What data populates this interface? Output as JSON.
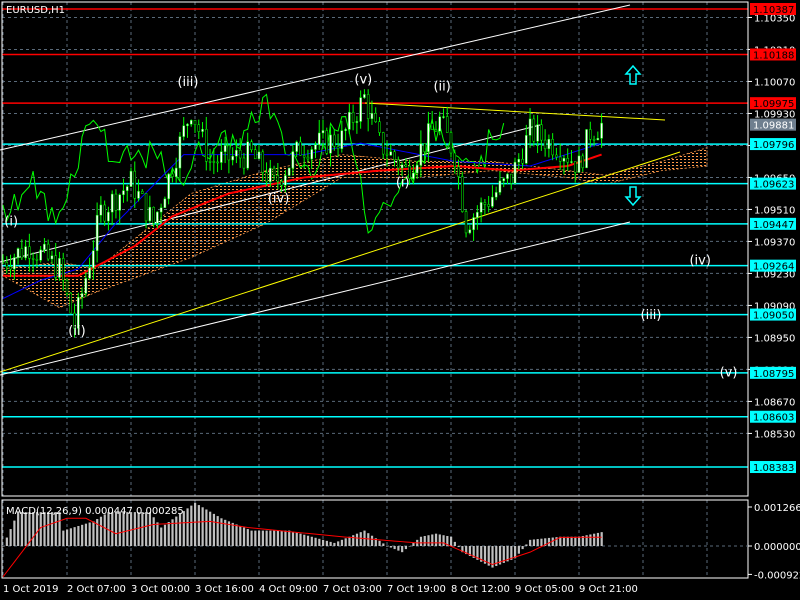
{
  "window_title": "EURUSD,H1",
  "colors": {
    "background": "#000000",
    "grid": "#5a6a7a",
    "red_level": "#ff0000",
    "cyan_level": "#00ffff",
    "bid": "#6f7f8f",
    "candle": "#00ff00",
    "kijun": "#ff0000",
    "tenkan": "#0000ff",
    "cloud": "#ff9b4a",
    "signal": "#ff0000",
    "hist": "#c0c0c0",
    "trend_yellow": "#ffff00",
    "trend_white": "#ffffff"
  },
  "chart_data": {
    "type": "candlestick",
    "symbol": "EURUSD",
    "timeframe": "H1",
    "ylim": [
      1.0826,
      1.1042
    ],
    "price_ticks": [
      "1.10350",
      "1.10210",
      "1.10070",
      "1.09930",
      "1.09790",
      "1.09650",
      "1.09510",
      "1.09370",
      "1.09230",
      "1.09090",
      "1.08950",
      "1.08810",
      "1.08670",
      "1.08530"
    ],
    "time_labels": [
      "1 Oct 2019",
      "2 Oct 07:00",
      "3 Oct 00:00",
      "3 Oct 16:00",
      "4 Oct 09:00",
      "7 Oct 03:00",
      "7 Oct 19:00",
      "8 Oct 12:00",
      "9 Oct 05:00",
      "9 Oct 21:00"
    ],
    "bars_per_label": 17,
    "levels_red": [
      "1.10387",
      "1.10188",
      "1.09975"
    ],
    "levels_cyan": [
      "1.09796",
      "1.09623",
      "1.09447",
      "1.09264",
      "1.09050",
      "1.08795",
      "1.08603",
      "1.08383"
    ],
    "bid": "1.09881",
    "price_path": [
      [
        0,
        1.0928
      ],
      [
        7,
        1.0935
      ],
      [
        15,
        1.0925
      ],
      [
        19,
        1.09
      ],
      [
        26,
        1.095
      ],
      [
        34,
        1.0963
      ],
      [
        40,
        1.0945
      ],
      [
        50,
        1.0995
      ],
      [
        55,
        1.0972
      ],
      [
        66,
        1.0975
      ],
      [
        72,
        1.0962
      ],
      [
        79,
        1.0978
      ],
      [
        90,
        1.0982
      ],
      [
        96,
        1.1
      ],
      [
        100,
        1.098
      ],
      [
        107,
        1.0968
      ],
      [
        116,
        1.099
      ],
      [
        120,
        1.0975
      ],
      [
        123,
        1.0945
      ],
      [
        127,
        1.0952
      ],
      [
        135,
        1.0965
      ],
      [
        140,
        1.0985
      ],
      [
        148,
        1.0978
      ],
      [
        153,
        1.097
      ],
      [
        156,
        1.0985
      ],
      [
        159,
        1.0988
      ]
    ],
    "kijun": [
      [
        0,
        1.0922
      ],
      [
        20,
        1.0922
      ],
      [
        35,
        1.0935
      ],
      [
        45,
        1.0948
      ],
      [
        60,
        1.0958
      ],
      [
        80,
        1.0965
      ],
      [
        100,
        1.0968
      ],
      [
        120,
        1.097
      ],
      [
        135,
        1.0968
      ],
      [
        150,
        1.097
      ],
      [
        159,
        1.0975
      ]
    ],
    "tenkan": [
      [
        0,
        1.0912
      ],
      [
        10,
        1.092
      ],
      [
        20,
        1.0925
      ],
      [
        30,
        1.0945
      ],
      [
        48,
        1.0975
      ],
      [
        80,
        1.0975
      ],
      [
        95,
        1.098
      ],
      [
        120,
        1.0972
      ],
      [
        140,
        1.097
      ],
      [
        159,
        1.098
      ]
    ],
    "cloud": [
      [
        0,
        1.0925,
        1.0922
      ],
      [
        15,
        1.0928,
        1.0908
      ],
      [
        25,
        1.0925,
        1.0915
      ],
      [
        50,
        1.0958,
        1.093
      ],
      [
        70,
        1.0968,
        1.0945
      ],
      [
        90,
        1.0975,
        1.0965
      ],
      [
        110,
        1.0972,
        1.0965
      ],
      [
        130,
        1.0972,
        1.0968
      ],
      [
        150,
        1.0968,
        1.0965
      ],
      [
        160,
        1.0966,
        1.0962
      ],
      [
        175,
        1.0972,
        1.0968
      ],
      [
        187,
        1.0978,
        1.097
      ]
    ],
    "waves": [
      {
        "label": "(i)",
        "bar": 3,
        "price": 1.0944
      },
      {
        "label": "(ii)",
        "bar": 20,
        "price": 1.0896
      },
      {
        "label": "(iii)",
        "bar": 49,
        "price": 1.1005
      },
      {
        "label": "(iv)",
        "bar": 73,
        "price": 1.0954
      },
      {
        "label": "(v)",
        "bar": 96,
        "price": 1.1006
      },
      {
        "label": "(i)",
        "bar": 107,
        "price": 1.0961
      },
      {
        "label": "(ii)",
        "bar": 117,
        "price": 1.1003
      },
      {
        "label": "(iv)",
        "bar": 185,
        "price": 1.0927
      },
      {
        "label": "(iii)",
        "bar": 172,
        "price": 1.0903
      },
      {
        "label": "(v)",
        "bar": 193,
        "price": 1.0878
      }
    ],
    "macd": {
      "label": "MACD(12,26,9) 0.000447 0.000285",
      "ylim": [
        -0.000922,
        0.001266
      ],
      "ticks": [
        "0.001266",
        "0.000000",
        "-0.000922"
      ],
      "hist": [
        [
          0,
          0
        ],
        [
          4,
          0.0011
        ],
        [
          15,
          0.0011
        ],
        [
          16,
          0.0005
        ],
        [
          24,
          0.0008
        ],
        [
          28,
          0.0011
        ],
        [
          39,
          0.0011
        ],
        [
          42,
          0.0006
        ],
        [
          51,
          0.0014
        ],
        [
          58,
          0.0009
        ],
        [
          66,
          0.0005
        ],
        [
          76,
          0.0005
        ],
        [
          88,
          0.0001
        ],
        [
          96,
          0.0005
        ],
        [
          102,
          0.0
        ],
        [
          106,
          -0.0002
        ],
        [
          111,
          0.0003
        ],
        [
          115,
          0.0004
        ],
        [
          119,
          0.0003
        ],
        [
          122,
          -0.0002
        ],
        [
          130,
          -0.0007
        ],
        [
          136,
          -0.0004
        ],
        [
          140,
          0.0002
        ],
        [
          148,
          0.0003
        ],
        [
          153,
          0.0003
        ],
        [
          159,
          0.00045
        ]
      ],
      "signal": [
        [
          0,
          -0.001
        ],
        [
          10,
          0.0006
        ],
        [
          17,
          0.0009
        ],
        [
          22,
          0.0009
        ],
        [
          30,
          0.0004
        ],
        [
          40,
          0.0007
        ],
        [
          55,
          0.0008
        ],
        [
          65,
          0.0006
        ],
        [
          90,
          0.0003
        ],
        [
          110,
          0.0001
        ],
        [
          117,
          0.0001
        ],
        [
          130,
          -0.0006
        ],
        [
          140,
          -0.0002
        ],
        [
          148,
          0.00028
        ],
        [
          159,
          0.000285
        ]
      ]
    }
  }
}
